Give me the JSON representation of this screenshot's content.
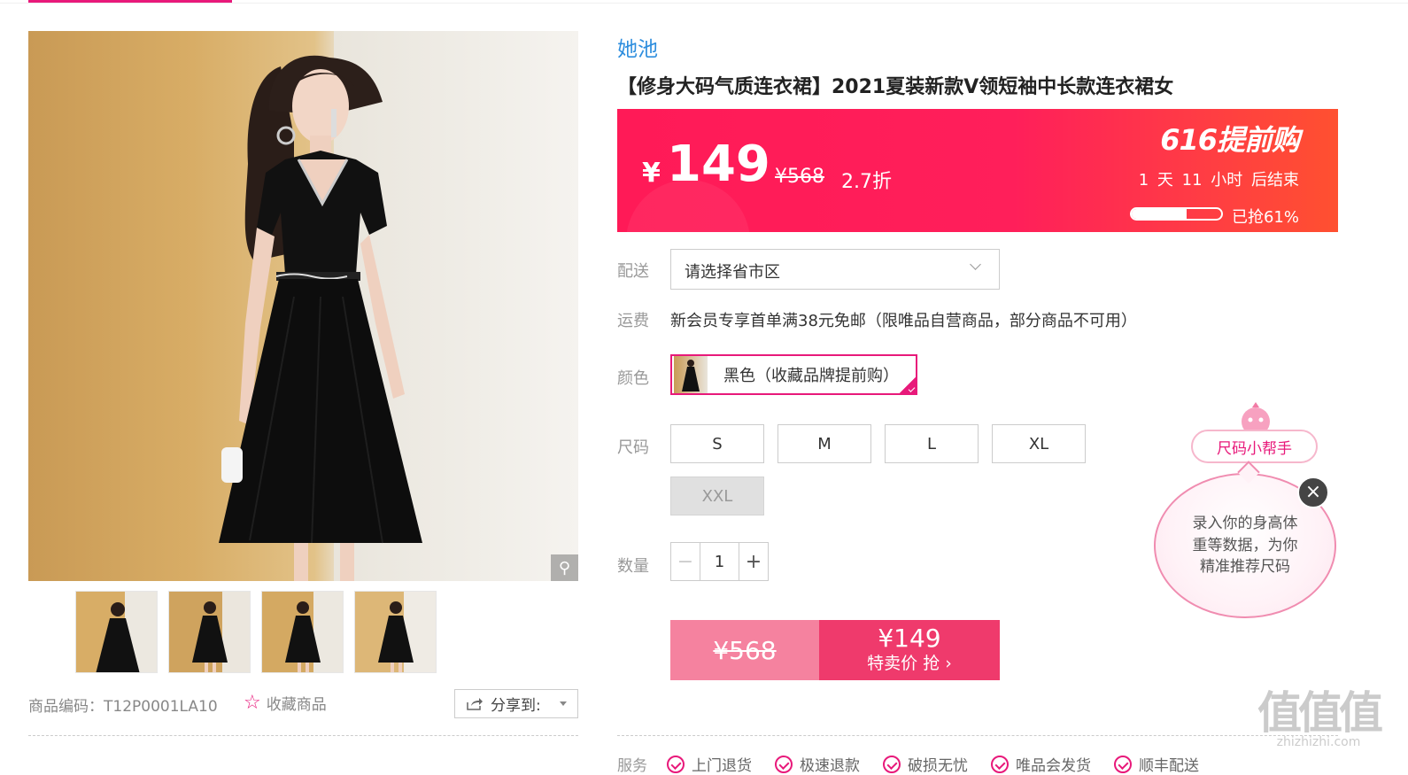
{
  "gallery": {
    "thumbnails": [
      "thumb-1",
      "thumb-2",
      "thumb-3",
      "thumb-4"
    ],
    "sku_label": "商品编码：T12P0001LA10",
    "favorite_label": "收藏商品",
    "share_label": "分享到:"
  },
  "product": {
    "brand": "她池",
    "title": "【修身大码气质连衣裙】2021夏装新款V领短袖中长款连衣裙女"
  },
  "price_box": {
    "currency": "¥",
    "price": "149",
    "original_price": "¥568",
    "discount": "2.7折",
    "promo": "616提前购",
    "countdown": "1 天 11 小时 后结束",
    "progress_fraction": 0.61,
    "sold_text": "已抢61%"
  },
  "delivery": {
    "label": "配送",
    "placeholder": "请选择省市区"
  },
  "shipping": {
    "label": "运费",
    "text": "新会员专享首单满38元免邮（限唯品自营商品，部分商品不可用）"
  },
  "color": {
    "label": "颜色",
    "selected": "黑色（收藏品牌提前购）"
  },
  "size": {
    "label": "尺码",
    "options": [
      "S",
      "M",
      "L",
      "XL",
      "XXL"
    ],
    "disabled": [
      "XXL"
    ]
  },
  "quantity": {
    "label": "数量",
    "value": "1",
    "minus": "−",
    "plus": "+"
  },
  "buy": {
    "original": "¥568",
    "price": "¥149",
    "action": "特卖价 抢 ›"
  },
  "services": {
    "label": "服务",
    "items": [
      "上门退货",
      "极速退款",
      "破损无忧",
      "唯品会发货",
      "顺丰配送"
    ]
  },
  "size_helper": {
    "button": "尺码小帮手",
    "bubble": "录入你的身高体重等数据，为你精准推荐尺码",
    "close": "×"
  },
  "watermark": {
    "big": "值值值",
    "small": "zhizhizhi.com"
  },
  "colors": {
    "accent": "#e8197a",
    "price_bg": "#ff1f5a",
    "brand_link": "#2e8ede"
  }
}
